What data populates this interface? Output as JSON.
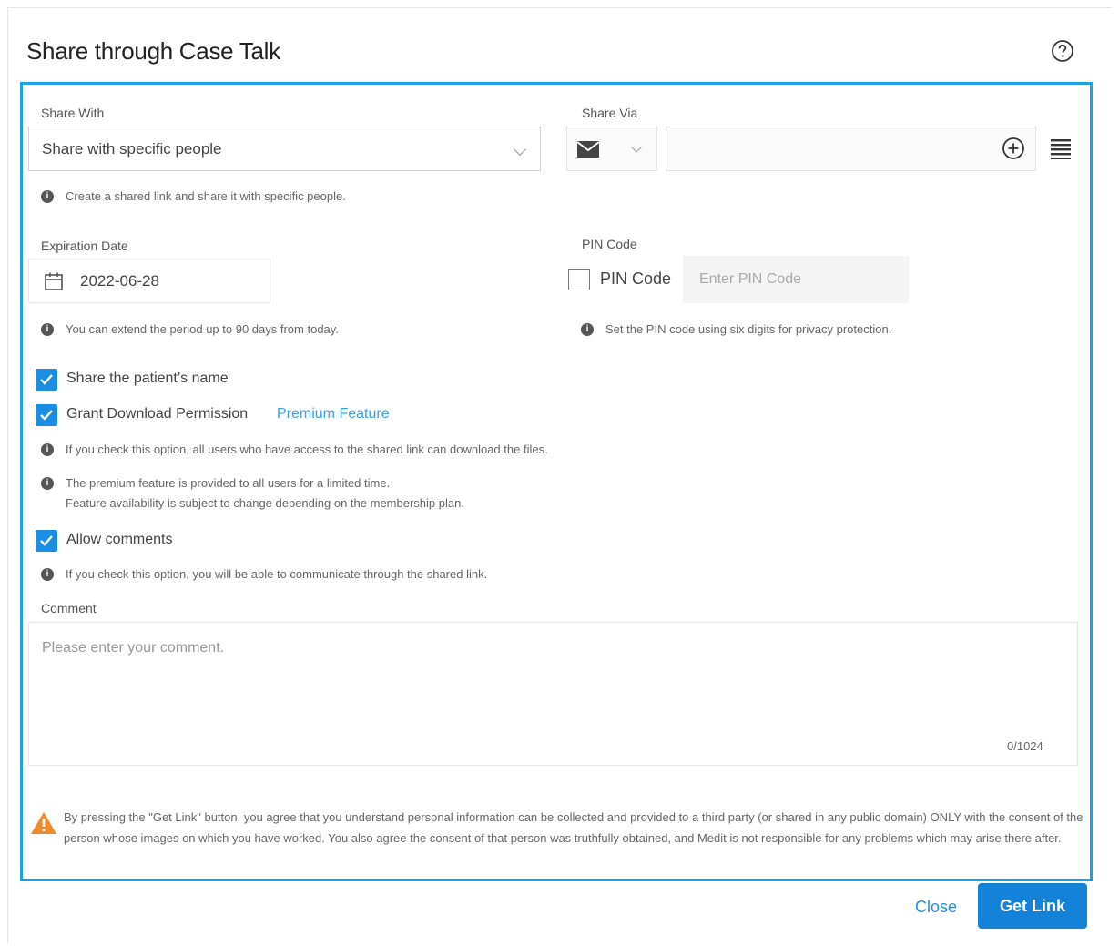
{
  "dialog": {
    "title": "Share through Case Talk",
    "help_icon": "question-circle-icon"
  },
  "share_with": {
    "label": "Share With",
    "selected": "Share with specific people",
    "hint": "Create a shared link and share it with specific people."
  },
  "share_via": {
    "label": "Share Via",
    "method_icon": "envelope-icon",
    "add_icon": "plus-circle-icon",
    "list_icon": "list-icon",
    "recipient_value": ""
  },
  "expiration": {
    "label": "Expiration Date",
    "value": "2022-06-28",
    "hint": "You can extend the period up to 90 days from today."
  },
  "pin": {
    "label": "PIN Code",
    "checkbox_label": "PIN Code",
    "checked": false,
    "placeholder": "Enter PIN Code",
    "hint": "Set the PIN code using six digits for privacy protection."
  },
  "options": {
    "share_name": {
      "label": "Share the patient’s name",
      "checked": true
    },
    "download": {
      "label": "Grant Download Permission",
      "checked": true,
      "badge": "Premium Feature",
      "hint1": "If you check this option, all users who have access to the shared link can download the files.",
      "hint2_line1": "The premium feature is provided to all users for a limited time.",
      "hint2_line2": "Feature availability is subject to change depending on the membership plan."
    },
    "comments": {
      "label": "Allow comments",
      "checked": true,
      "hint": "If you check this option, you will be able to communicate through the shared link."
    }
  },
  "comment": {
    "label": "Comment",
    "placeholder": "Please enter your comment.",
    "counter": "0/1024"
  },
  "warning": {
    "text": "By pressing the \"Get Link\" button, you agree that you understand personal information can be collected and provided to a third party (or shared in any public domain) ONLY with the consent of the person whose images on which you have worked. You also agree the consent of that person was truthfully obtained, and Medit is not responsible for any problems which may arise there after."
  },
  "footer": {
    "close_label": "Close",
    "get_link_label": "Get Link"
  },
  "colors": {
    "frame": "#1aa3e0",
    "primary": "#1482d8",
    "checkbox": "#1b8ee3",
    "warning": "#f0892b"
  }
}
